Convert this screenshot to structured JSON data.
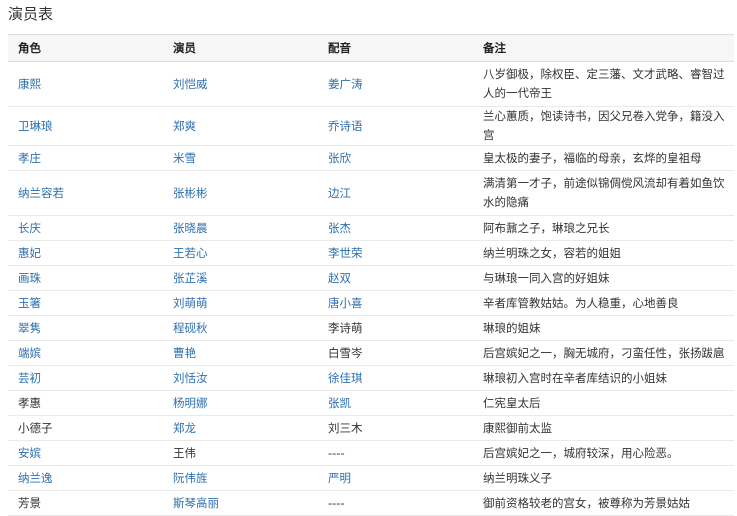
{
  "page": {
    "title": "演员表"
  },
  "table": {
    "headers": {
      "role": "角色",
      "actor": "演员",
      "voice": "配音",
      "note": "备注"
    },
    "rows": [
      {
        "role": "康熙",
        "role_link": true,
        "actor": "刘恺威",
        "actor_link": true,
        "voice": "姜广涛",
        "voice_link": true,
        "note": "八岁御极，除权臣、定三藩、文才武略、睿智过人的一代帝王",
        "tall": true
      },
      {
        "role": "卫琳琅",
        "role_link": true,
        "actor": "郑爽",
        "actor_link": true,
        "voice": "乔诗语",
        "voice_link": true,
        "note": "兰心蕙质，饱读诗书，因父兄卷入党争，籍没入宫"
      },
      {
        "role": "孝庄",
        "role_link": true,
        "actor": "米雪",
        "actor_link": true,
        "voice": "张欣",
        "voice_link": true,
        "note": "皇太极的妻子，福临的母亲，玄烨的皇祖母"
      },
      {
        "role": "纳兰容若",
        "role_link": true,
        "actor": "张彬彬",
        "actor_link": true,
        "voice": "边江",
        "voice_link": true,
        "note": "满清第一才子，前途似锦倜傥风流却有着如鱼饮水的隐痛",
        "tall": true
      },
      {
        "role": "长庆",
        "role_link": true,
        "actor": "张晓晨",
        "actor_link": true,
        "voice": "张杰",
        "voice_link": true,
        "note": "阿布鼐之子，琳琅之兄长"
      },
      {
        "role": "惠妃",
        "role_link": true,
        "actor": "王若心",
        "actor_link": true,
        "voice": "李世荣",
        "voice_link": true,
        "note": "纳兰明珠之女，容若的姐姐"
      },
      {
        "role": "画珠",
        "role_link": true,
        "actor": "张芷溪",
        "actor_link": true,
        "voice": "赵双",
        "voice_link": true,
        "note": "与琳琅一同入宫的好姐妹"
      },
      {
        "role": "玉箸",
        "role_link": true,
        "actor": "刘萌萌",
        "actor_link": true,
        "voice": "唐小喜",
        "voice_link": true,
        "note": "辛者库管教姑姑。为人稳重，心地善良"
      },
      {
        "role": "翠隽",
        "role_link": true,
        "actor": "程砚秋",
        "actor_link": true,
        "voice": "李诗萌",
        "voice_link": false,
        "note": "琳琅的姐妹"
      },
      {
        "role": "端嫔",
        "role_link": true,
        "actor": "曹艳",
        "actor_link": true,
        "voice": "白雪岑",
        "voice_link": false,
        "note": "后宫嫔妃之一，胸无城府，刁蛮任性，张扬跋扈"
      },
      {
        "role": "芸初",
        "role_link": true,
        "actor": "刘恬汝",
        "actor_link": true,
        "voice": "徐佳琪",
        "voice_link": true,
        "note": "琳琅初入宫时在辛者库结识的小姐妹"
      },
      {
        "role": "孝惠",
        "role_link": false,
        "actor": "杨明娜",
        "actor_link": true,
        "voice": "张凯",
        "voice_link": true,
        "note": "仁宪皇太后"
      },
      {
        "role": "小德子",
        "role_link": false,
        "actor": "郑龙",
        "actor_link": true,
        "voice": "刘三木",
        "voice_link": false,
        "note": "康熙御前太监"
      },
      {
        "role": "安嫔",
        "role_link": true,
        "actor": "王伟",
        "actor_link": false,
        "voice": "----",
        "voice_link": false,
        "note": "后宫嫔妃之一，城府较深，用心险恶。"
      },
      {
        "role": "纳兰逸",
        "role_link": true,
        "actor": "阮伟旌",
        "actor_link": true,
        "voice": "严明",
        "voice_link": true,
        "note": "纳兰明珠义子"
      },
      {
        "role": "芳景",
        "role_link": false,
        "actor": "斯琴高丽",
        "actor_link": true,
        "voice": "----",
        "voice_link": false,
        "note": "御前资格较老的宫女，被尊称为芳景姑姑"
      }
    ]
  }
}
